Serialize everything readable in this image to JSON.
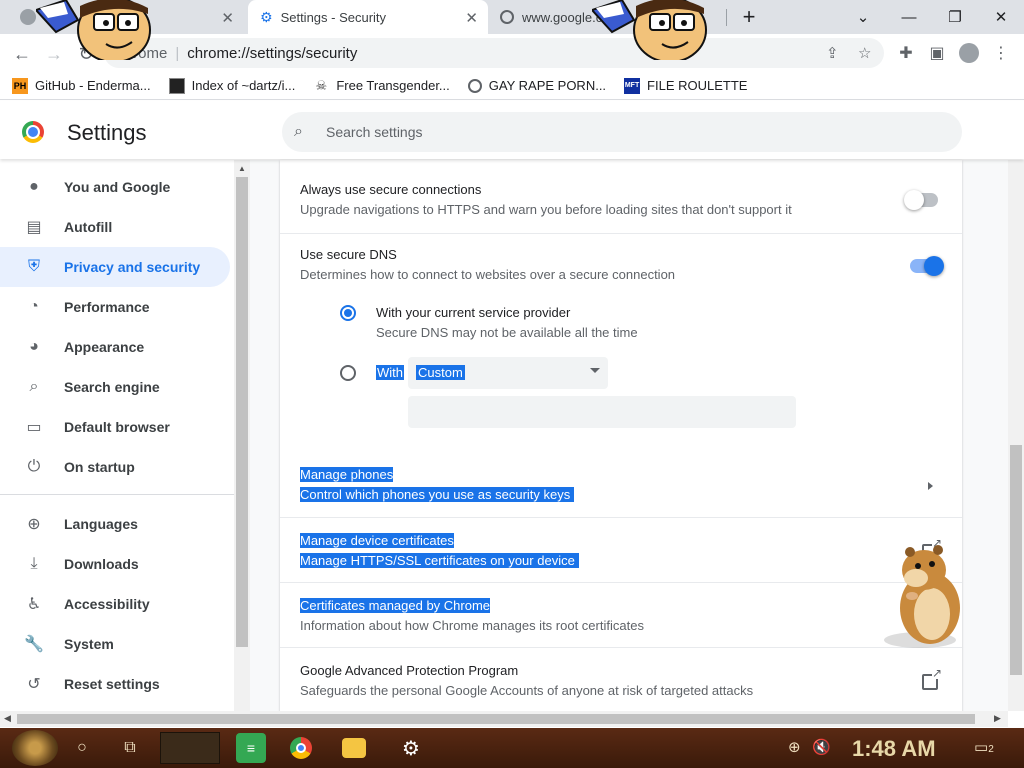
{
  "tabs": [
    {
      "title": "",
      "active": false
    },
    {
      "title": "Settings - Security",
      "active": true
    },
    {
      "title": "www.google.c",
      "active": false
    }
  ],
  "window_controls": {
    "minimize": "—",
    "restore": "❐",
    "close": "✕",
    "new_tab": "+",
    "tab_search": "⌄"
  },
  "toolbar": {
    "site_label": "Chrome",
    "url": "chrome://settings/security"
  },
  "bookmarks": [
    {
      "label": "GitHub - Enderma...",
      "icon": "PH"
    },
    {
      "label": "Index of ~dartz/i...",
      "icon": ""
    },
    {
      "label": "Free Transgender...",
      "icon": ""
    },
    {
      "label": "GAY RAPE PORN...",
      "icon": ""
    },
    {
      "label": "FILE ROULETTE",
      "icon": "MFT"
    }
  ],
  "header": {
    "title": "Settings",
    "search_placeholder": "Search settings"
  },
  "sidebar": {
    "items": [
      {
        "label": "You and Google",
        "icon": "person-icon"
      },
      {
        "label": "Autofill",
        "icon": "clipboard-icon"
      },
      {
        "label": "Privacy and security",
        "icon": "shield-icon",
        "active": true
      },
      {
        "label": "Performance",
        "icon": "gauge-icon"
      },
      {
        "label": "Appearance",
        "icon": "palette-icon"
      },
      {
        "label": "Search engine",
        "icon": "search-icon"
      },
      {
        "label": "Default browser",
        "icon": "browser-icon"
      },
      {
        "label": "On startup",
        "icon": "power-icon"
      },
      {
        "label": "Languages",
        "icon": "globe-icon"
      },
      {
        "label": "Downloads",
        "icon": "download-icon"
      },
      {
        "label": "Accessibility",
        "icon": "accessibility-icon"
      },
      {
        "label": "System",
        "icon": "wrench-icon"
      },
      {
        "label": "Reset settings",
        "icon": "reset-icon"
      }
    ]
  },
  "security": {
    "secure_connections": {
      "title": "Always use secure connections",
      "subtitle": "Upgrade navigations to HTTPS and warn you before loading sites that don't support it",
      "enabled": false
    },
    "secure_dns": {
      "title": "Use secure DNS",
      "subtitle": "Determines how to connect to websites over a secure connection",
      "enabled": true,
      "option_current": {
        "title": "With your current service provider",
        "subtitle": "Secure DNS may not be available all the time",
        "selected": true
      },
      "option_custom": {
        "label": "With",
        "select_value": "Custom",
        "selected": false,
        "input_value": ""
      }
    },
    "manage_phones": {
      "title": "Manage phones",
      "subtitle": "Control which phones you use as security keys"
    },
    "device_certs": {
      "title": "Manage device certificates",
      "subtitle": "Manage HTTPS/SSL certificates on your device"
    },
    "chrome_certs": {
      "title": "Certificates managed by Chrome",
      "subtitle": "Information about how Chrome manages its root certificates"
    },
    "advanced_protection": {
      "title": "Google Advanced Protection Program",
      "subtitle": "Safeguards the personal Google Accounts of anyone at risk of targeted attacks"
    }
  },
  "colors": {
    "accent": "#1a73e8",
    "active_bg": "#e8f0fe"
  },
  "taskbar": {
    "clock": "1:48 AM",
    "notifications": "2"
  }
}
